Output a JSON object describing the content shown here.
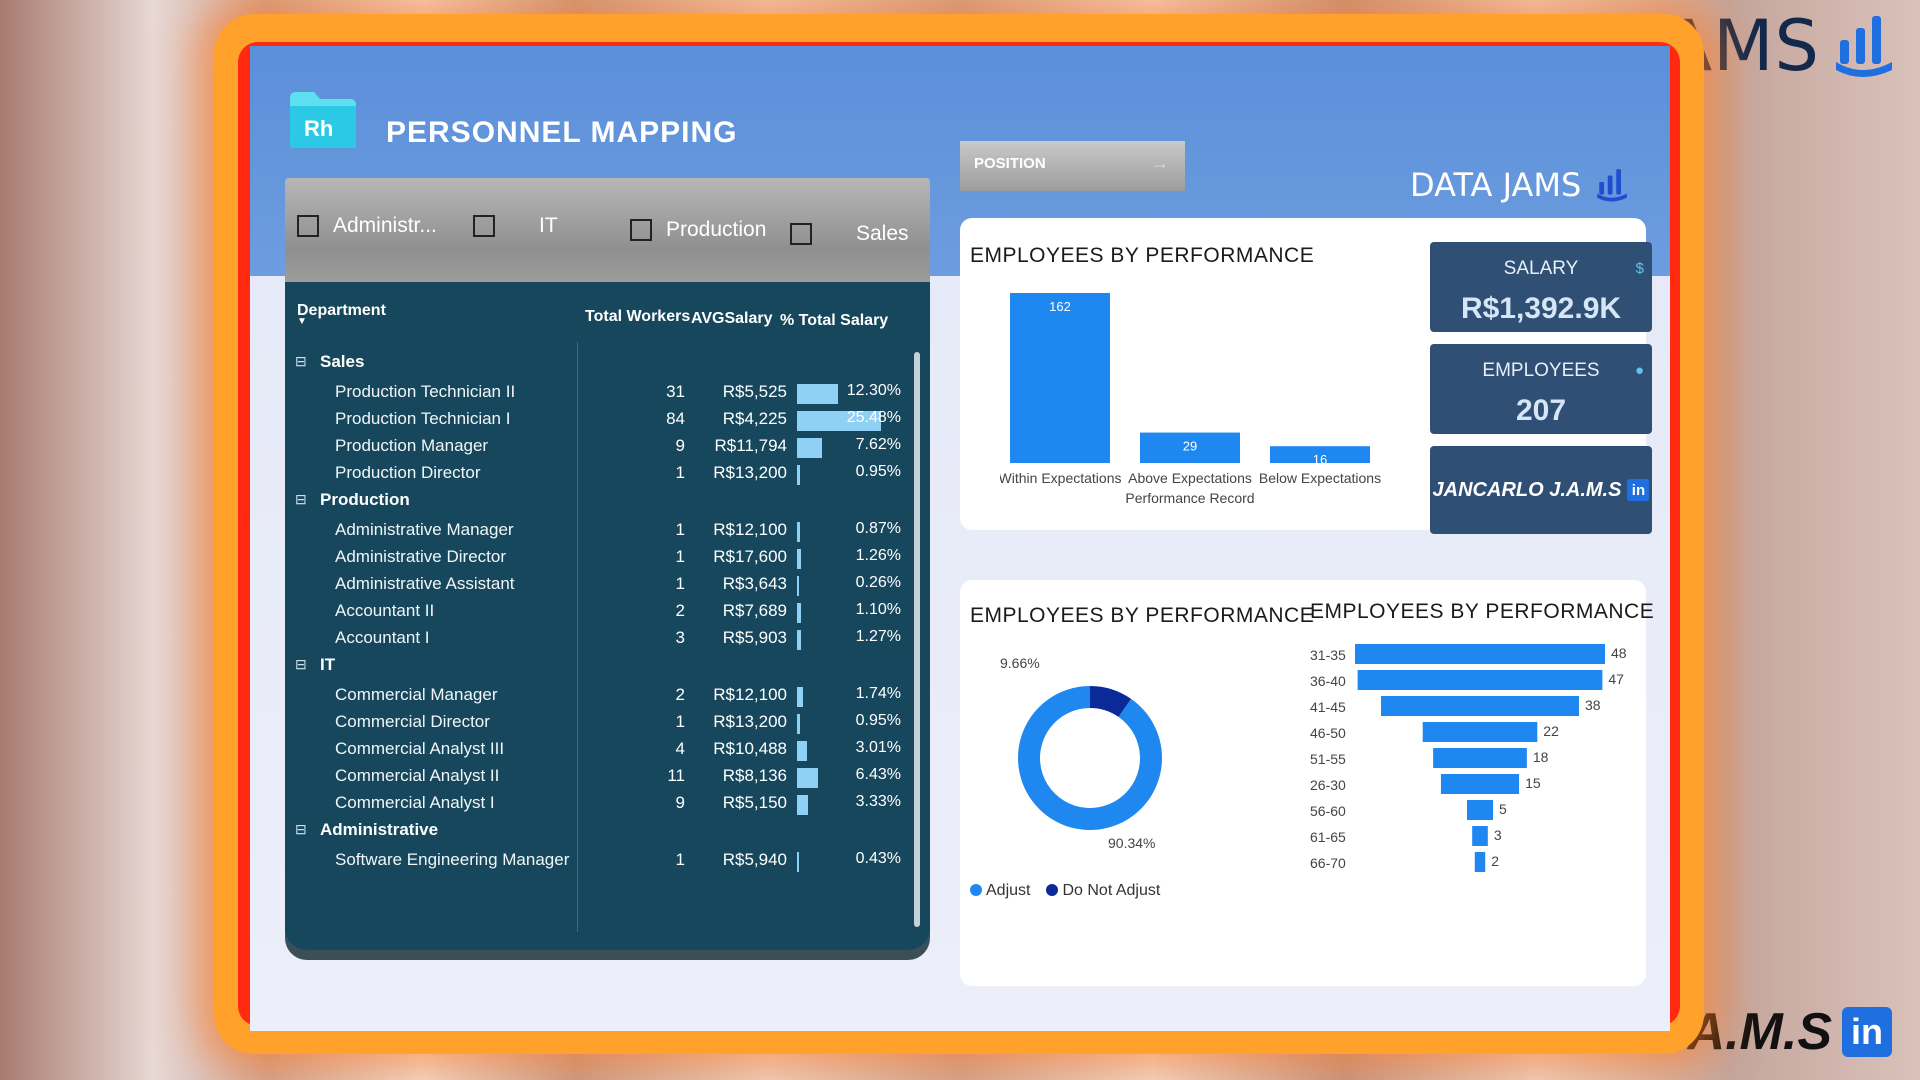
{
  "brand": {
    "name": "DATA JAMS",
    "author": "JANCARLO J.A.M.S",
    "linkedin_glyph": "in"
  },
  "header": {
    "logo_text": "Rh",
    "title": "PERSONNEL MAPPING"
  },
  "slicer": {
    "items": [
      {
        "label": "Administr..."
      },
      {
        "label": "IT"
      },
      {
        "label": "Production"
      },
      {
        "label": "Sales"
      }
    ]
  },
  "table": {
    "columns": [
      "Department",
      "Total Workers",
      "AVGSalary",
      "% Total Salary"
    ],
    "groups": [
      {
        "name": "Sales",
        "rows": [
          {
            "label": "Production Technician II",
            "workers": "31",
            "avg": "R$5,525",
            "pct": "12.30%",
            "share": 12.3
          },
          {
            "label": "Production Technician I",
            "workers": "84",
            "avg": "R$4,225",
            "pct": "25.48%",
            "share": 25.48
          },
          {
            "label": "Production Manager",
            "workers": "9",
            "avg": "R$11,794",
            "pct": "7.62%",
            "share": 7.62
          },
          {
            "label": "Production Director",
            "workers": "1",
            "avg": "R$13,200",
            "pct": "0.95%",
            "share": 0.95
          }
        ]
      },
      {
        "name": "Production",
        "rows": [
          {
            "label": "Administrative Manager",
            "workers": "1",
            "avg": "R$12,100",
            "pct": "0.87%",
            "share": 0.87
          },
          {
            "label": "Administrative Director",
            "workers": "1",
            "avg": "R$17,600",
            "pct": "1.26%",
            "share": 1.26
          },
          {
            "label": "Administrative Assistant",
            "workers": "1",
            "avg": "R$3,643",
            "pct": "0.26%",
            "share": 0.26
          },
          {
            "label": "Accountant II",
            "workers": "2",
            "avg": "R$7,689",
            "pct": "1.10%",
            "share": 1.1
          },
          {
            "label": "Accountant I",
            "workers": "3",
            "avg": "R$5,903",
            "pct": "1.27%",
            "share": 1.27
          }
        ]
      },
      {
        "name": "IT",
        "rows": [
          {
            "label": "Commercial Manager",
            "workers": "2",
            "avg": "R$12,100",
            "pct": "1.74%",
            "share": 1.74
          },
          {
            "label": "Commercial Director",
            "workers": "1",
            "avg": "R$13,200",
            "pct": "0.95%",
            "share": 0.95
          },
          {
            "label": "Commercial Analyst III",
            "workers": "4",
            "avg": "R$10,488",
            "pct": "3.01%",
            "share": 3.01
          },
          {
            "label": "Commercial Analyst II",
            "workers": "11",
            "avg": "R$8,136",
            "pct": "6.43%",
            "share": 6.43
          },
          {
            "label": "Commercial Analyst I",
            "workers": "9",
            "avg": "R$5,150",
            "pct": "3.33%",
            "share": 3.33
          }
        ]
      },
      {
        "name": "Administrative",
        "rows": [
          {
            "label": "Software Engineering Manager",
            "workers": "1",
            "avg": "R$5,940",
            "pct": "0.43%",
            "share": 0.43
          }
        ]
      }
    ]
  },
  "position_button": {
    "label": "POSITION",
    "arrow": "→"
  },
  "kpis": {
    "salary": {
      "label": "SALARY",
      "value": "R$1,392.9K"
    },
    "employees": {
      "label": "EMPLOYEES",
      "value": "207"
    },
    "author": {
      "label": "JANCARLO J.A.M.S",
      "glyph": "in"
    }
  },
  "colors": {
    "accent": "#1e88f0",
    "dark_series": "#0b2a9a",
    "panel": "#17475c",
    "kpi": "#2f4f75"
  },
  "chart_data": [
    {
      "type": "bar",
      "title": "EMPLOYEES BY PERFORMANCE",
      "xlabel": "Performance Record",
      "categories": [
        "Within Expectations",
        "Above Expectations",
        "Below Expectations"
      ],
      "values": [
        162,
        29,
        16
      ],
      "ylim": [
        0,
        162
      ]
    },
    {
      "type": "pie",
      "title": "EMPLOYEES BY PERFORMANCE",
      "labels": [
        "Adjust",
        "Do Not Adjust"
      ],
      "values": [
        90.34,
        9.66
      ],
      "value_labels": [
        "90.34%",
        "9.66%"
      ],
      "legend": "bottom-left"
    },
    {
      "type": "bar",
      "title": "EMPLOYEES BY PERFORMANCE",
      "categories": [
        "31-35",
        "36-40",
        "41-45",
        "46-50",
        "51-55",
        "26-30",
        "56-60",
        "61-65",
        "66-70"
      ],
      "values": [
        48,
        47,
        38,
        22,
        18,
        15,
        5,
        3,
        2
      ]
    }
  ]
}
